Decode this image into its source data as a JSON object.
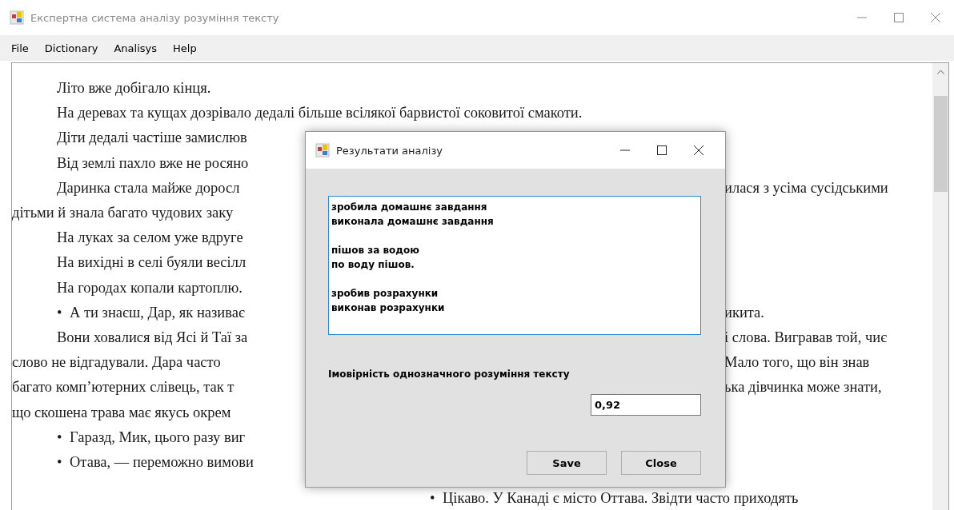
{
  "window": {
    "title": "Експертна система аналізу розуміння тексту"
  },
  "menu": [
    "File",
    "Dictionary",
    "Analisys",
    "Help"
  ],
  "document": {
    "lines": [
      {
        "kind": "paragraph",
        "left": "Літо вже добігало кінця."
      },
      {
        "kind": "paragraph",
        "left": "На деревах та кущах дозрівало дедалі більше всілякої барвистої соковитої смакоти."
      },
      {
        "kind": "paragraph",
        "left": "Діти дедалі частіше замислюв"
      },
      {
        "kind": "paragraph",
        "left": "Від землі пахло вже не росяно"
      },
      {
        "kind": "paragraph",
        "left": "Даринка стала майже доросл",
        "right": "илася з усіма сусідськими"
      },
      {
        "kind": "continuation",
        "left": "дітьми й знала багато чудових заку"
      },
      {
        "kind": "paragraph",
        "left": "На луках за селом уже вдруге"
      },
      {
        "kind": "paragraph",
        "left": "На вихідні в селі буяли весілл"
      },
      {
        "kind": "paragraph",
        "left": "На городах копали картоплю."
      },
      {
        "kind": "bullet",
        "marker": "•",
        "left": "А ти знаєш, Дар, як називає",
        "right": "икита."
      },
      {
        "kind": "paragraph",
        "left": "Вони ховалися від Ясі й Таї за",
        "right": "і слова. Вигравав той, чиє"
      },
      {
        "kind": "continuation",
        "left": "слово не відгадували. Дара часто",
        "right": "Мало того, що він знав"
      },
      {
        "kind": "continuation",
        "left": "багато комп’ютерних слівець, так т",
        "right": "ька дівчинка може знати,"
      },
      {
        "kind": "continuation",
        "left": "що скошена трава має якусь окрем"
      },
      {
        "kind": "bullet",
        "marker": "•",
        "left": "Гаразд, Мик, цього разу виг"
      },
      {
        "kind": "bullet",
        "marker": "•",
        "left": "Отава, — переможно вимови"
      },
      {
        "kind": "tail",
        "marker": "•",
        "right": "Цікаво. У Канаді є місто Оттава. Звідти часто приходять"
      }
    ]
  },
  "dialog": {
    "title": "Результати аналізу",
    "results": [
      [
        "зробила домашнє завдання",
        "виконала домашнє завдання"
      ],
      [
        "пішов за водою",
        "по воду пішов."
      ],
      [
        "зробив розрахунки",
        "виконав розрахунки"
      ]
    ],
    "probability_label": "Імовірність однозначного розуміння тексту",
    "probability_value": "0,92",
    "buttons": [
      "Save",
      "Close"
    ]
  }
}
